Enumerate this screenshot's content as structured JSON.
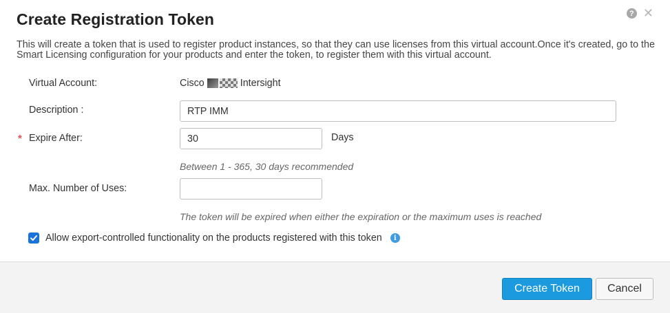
{
  "dialog": {
    "title": "Create Registration Token",
    "description": "This will create a token that is used to register product instances, so that they can use licenses from this virtual account.Once it's created, go to the Smart Licensing configuration for your products and enter the token, to register them with this virtual account."
  },
  "form": {
    "virtual_account": {
      "label": "Virtual Account:",
      "value_prefix": "Cisco",
      "value_suffix": "Intersight"
    },
    "description": {
      "label": "Description :",
      "value": "RTP IMM"
    },
    "expire_after": {
      "required_marker": "*",
      "label": "Expire After:",
      "value": "30",
      "unit": "Days",
      "hint": "Between 1 - 365, 30 days recommended"
    },
    "max_uses": {
      "label": "Max. Number of Uses:",
      "value": "",
      "hint": "The token will be expired when either the expiration or the maximum uses is reached"
    },
    "export_controlled": {
      "checked": true,
      "label": "Allow export-controlled functionality on the products registered with this token"
    }
  },
  "icons": {
    "help": "help-circle-icon",
    "close": "close-icon",
    "info": "info-circle-icon",
    "check": "checkmark-icon"
  },
  "buttons": {
    "create": "Create Token",
    "cancel": "Cancel"
  },
  "colors": {
    "primary": "#1b9ae0",
    "checkbox": "#1a73d9",
    "info": "#3d9ce3",
    "required": "#d9534f",
    "footer_bg": "#f3f3f3"
  }
}
